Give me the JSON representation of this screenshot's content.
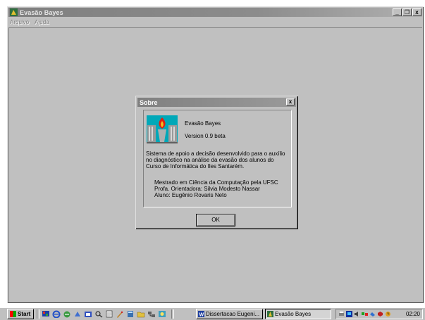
{
  "app": {
    "title": "Evasão Bayes",
    "menu": [
      "Arquivo",
      "Ajuda"
    ],
    "window_buttons": {
      "minimize": "_",
      "maximize": "❐",
      "close": "x"
    }
  },
  "dialog": {
    "title": "Sobre",
    "close": "x",
    "product_name": "Evasão Bayes",
    "version": "Version 0.9 beta",
    "description": "Sistema de apoio a decisão desenvolvido para o auxílio no diagnóstico na análise da evasão dos alunos do Curso de Informática do Iles Santarém.",
    "credits": [
      "Mestrado em Ciência da Computação pela UFSC",
      "Profa.  Orientadora: Silvia Modesto Nassar",
      "Aluno: Eugênio Rovaris Neto"
    ],
    "ok_label": "OK"
  },
  "taskbar": {
    "start_label": "Start",
    "tasks": [
      {
        "label": "Dissertacao Eugeni...",
        "icon": "word-icon",
        "active": false
      },
      {
        "label": "Evasão Bayes",
        "icon": "app-icon",
        "active": true
      }
    ],
    "clock": "02:20"
  }
}
